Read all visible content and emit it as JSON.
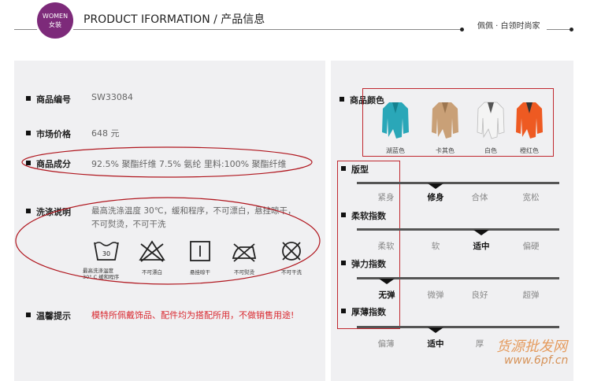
{
  "header": {
    "badge_line1": "WOMEN",
    "badge_line2": "女装",
    "title": "PRODUCT IFORMATION / 产品信息",
    "brand": "佩佩 · 白领时尚家"
  },
  "info": {
    "code_label": "商品编号",
    "code_value": "SW33084",
    "price_label": "市场价格",
    "price_value": "648 元",
    "comp_label": "商品成分",
    "comp_value": "92.5% 聚酯纤维 7.5% 氨纶 里料:100% 聚酯纤维",
    "wash_label": "洗涤说明",
    "wash_line1": "最高洗涤温度 30℃，缓和程序，不可漂白，悬挂晾干，",
    "wash_line2": "不可熨烫，不可干洗",
    "tip_label": "温馨提示",
    "tip_value": "模特所佩戴饰品、配件均为搭配所用，不做销售用途!"
  },
  "care_symbols": [
    {
      "icon": "wash-30-icon",
      "num": "30",
      "caption": "最高洗涤温度\n30° C 缓和程序"
    },
    {
      "icon": "no-bleach-icon",
      "caption": "不可漂白"
    },
    {
      "icon": "hang-dry-icon",
      "caption": "悬挂晾干"
    },
    {
      "icon": "no-iron-icon",
      "caption": "不可熨烫"
    },
    {
      "icon": "no-dryclean-icon",
      "caption": "不可干洗"
    }
  ],
  "colors": {
    "label": "商品颜色",
    "swatches": [
      {
        "name": "湖蓝色",
        "hex": "#2aa7b8"
      },
      {
        "name": "卡其色",
        "hex": "#c9a077"
      },
      {
        "name": "白色",
        "hex": "#f2f2f2"
      },
      {
        "name": "橙红色",
        "hex": "#ee5a22"
      }
    ]
  },
  "attributes": [
    {
      "label": "版型",
      "options": [
        "紧身",
        "修身",
        "合体",
        "宽松"
      ],
      "selected": 1
    },
    {
      "label": "柔软指数",
      "options": [
        "柔软",
        "软",
        "适中",
        "偏硬"
      ],
      "selected": 2
    },
    {
      "label": "弹力指数",
      "options": [
        "无弹",
        "微弹",
        "良好",
        "超弹"
      ],
      "selected": 0
    },
    {
      "label": "厚薄指数",
      "options": [
        "偏薄",
        "适中",
        "厚",
        ""
      ],
      "selected": 1
    }
  ],
  "watermark": {
    "line1": "货源批发网",
    "line2": "www.6pf.cn"
  }
}
